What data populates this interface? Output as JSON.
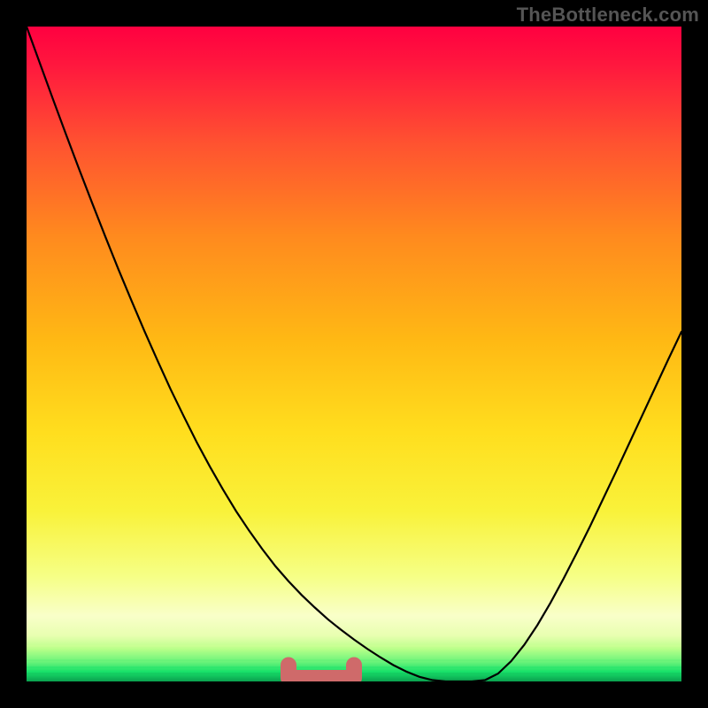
{
  "watermark": "TheBottleneck.com",
  "colors": {
    "frame_bg": "#000000",
    "curve": "#000000",
    "highlight": "#cf6a6a",
    "green_center": "#18e169",
    "gradient_top": "#ff0040",
    "gradient_mid_orange": "#ff8a1e",
    "gradient_yellow": "#ffe62a",
    "gradient_pale": "#f9ffc9"
  },
  "chart_data": {
    "type": "line",
    "title": "",
    "xlabel": "",
    "ylabel": "",
    "xlim": [
      0,
      100
    ],
    "ylim": [
      0,
      100
    ],
    "x": [
      0,
      2,
      4,
      6,
      8,
      10,
      12,
      14,
      16,
      18,
      20,
      22,
      24,
      26,
      28,
      30,
      32,
      34,
      36,
      38,
      40,
      42,
      44,
      46,
      48,
      50,
      52,
      54,
      56,
      58,
      60,
      62,
      64,
      66,
      68,
      70,
      72,
      74,
      76,
      78,
      80,
      82,
      84,
      86,
      88,
      90,
      92,
      94,
      96,
      98,
      100
    ],
    "values": [
      100,
      94.5,
      89,
      83.6,
      78.3,
      73.1,
      68,
      63,
      58.2,
      53.5,
      49,
      44.6,
      40.5,
      36.5,
      32.8,
      29.3,
      26,
      23,
      20.2,
      17.6,
      15.3,
      13.2,
      11.3,
      9.5,
      7.9,
      6.4,
      5,
      3.7,
      2.5,
      1.5,
      0.7,
      0.2,
      0,
      0,
      0,
      0.2,
      1.2,
      3.1,
      5.6,
      8.6,
      12,
      15.7,
      19.6,
      23.6,
      27.8,
      32,
      36.3,
      40.6,
      44.9,
      49.2,
      53.4
    ],
    "highlight_range_x": [
      40,
      50
    ],
    "highlight_y": 2.5,
    "notes": "V-shaped bottleneck curve over red→yellow→green vertical gradient; flat minimum segment highlighted with thick salmon stroke"
  }
}
